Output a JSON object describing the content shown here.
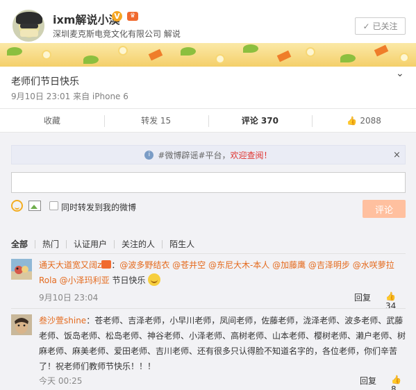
{
  "profile": {
    "name": "ixm解说小漠",
    "verified_badge": "V",
    "company": "深圳麦克斯电竞文化有限公司 解说",
    "follow_button": "已关注"
  },
  "post": {
    "text": "老师们节日快乐",
    "meta": "9月10日 23:01 来自 iPhone 6"
  },
  "actions": {
    "favorite": "收藏",
    "repost": "转发 15",
    "comment": "评论 370",
    "like": "2088"
  },
  "notice": {
    "text_prefix": "#微博辟谣#平台，",
    "text_link": "欢迎查阅！",
    "close": "×"
  },
  "composer": {
    "repost_label": "同时转发到我的微博",
    "submit": "评论"
  },
  "filters": [
    "全部",
    "热门",
    "认证用户",
    "关注的人",
    "陌生人"
  ],
  "comments": [
    {
      "name": "通天大道宽又阔z",
      "separator": "：",
      "mentions": "@波多野结衣 @苍井空 @东尼大木-本人 @加藤鹰 @吉泽明步 @水咲萝拉Rola @小泽玛利亚",
      "text": " 节日快乐",
      "time": "9月10日 23:04",
      "reply": "回复",
      "likes": "34"
    },
    {
      "name": "叁沙萱shine",
      "separator": "：",
      "text": "苍老师、吉泽老师，小早川老师，凤间老师，佐藤老师，泷泽老师、波多老师、武藤老师、饭岛老师、松岛老师、神谷老师、小泽老师、高树老师、山本老师、樱树老师、濑户老师、树麻老师、麻美老师、爱田老师、吉川老师、还有很多只认得脸不知道名字的，各位老师，你们辛苦了！祝老师们教师节快乐！！！",
      "time": "今天 00:25",
      "reply": "回复",
      "likes": "8"
    }
  ],
  "icons": {
    "chevron": "chevron-down-icon",
    "thumb": "thumb-up-icon",
    "info": "info-icon"
  },
  "colors": {
    "link_orange": "#e4691c",
    "submit_disabled": "#ffc09f",
    "notice_red": "#e0332f"
  }
}
